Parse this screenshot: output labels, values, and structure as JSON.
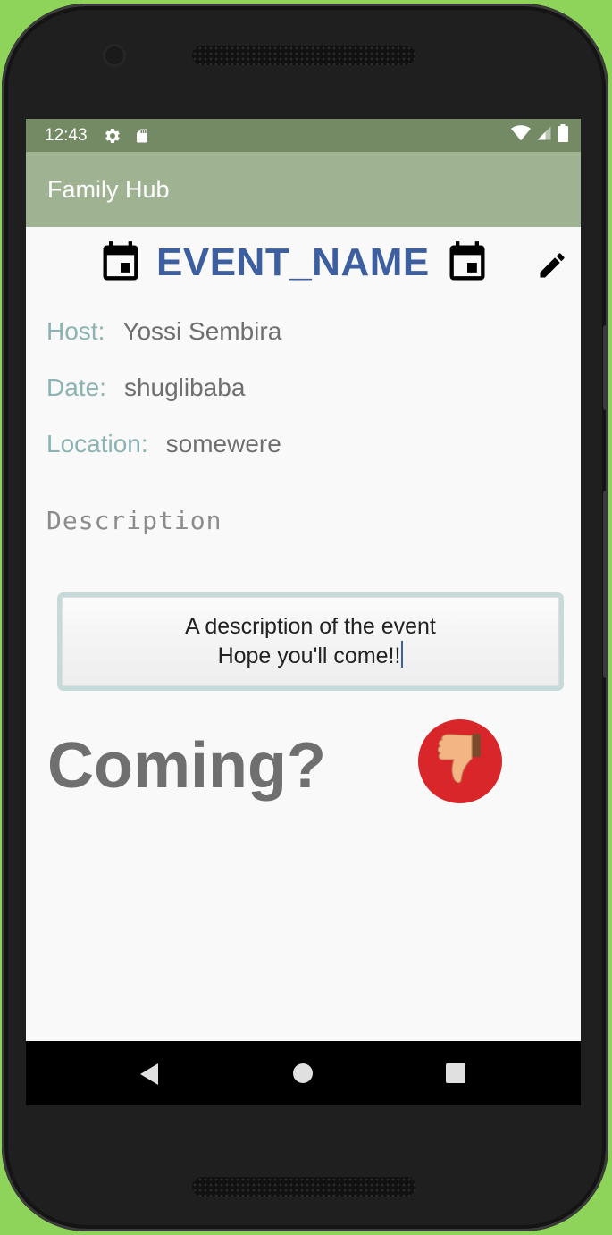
{
  "status_bar": {
    "time": "12:43",
    "icons_left": [
      "settings-icon",
      "sd-card-icon"
    ],
    "icons_right": [
      "wifi-icon",
      "signal-icon",
      "battery-icon"
    ]
  },
  "app_bar": {
    "title": "Family Hub"
  },
  "event": {
    "title": "EVENT_NAME",
    "fields": {
      "host": {
        "label": "Host:",
        "value": "Yossi Sembira"
      },
      "date": {
        "label": "Date:",
        "value": "shuglibaba"
      },
      "location": {
        "label": "Location:",
        "value": "somewere"
      }
    },
    "description_label": "Description",
    "description_lines": [
      "A description of the event",
      "Hope you'll come!!"
    ],
    "coming_label": "Coming?",
    "rsvp_icon": "thumbs-down-icon"
  },
  "colors": {
    "status_bar": "#738a64",
    "app_bar": "#9fb392",
    "title": "#3d5fa0",
    "field_label": "#8bb3b3",
    "rsvp_button": "#d8262a"
  }
}
